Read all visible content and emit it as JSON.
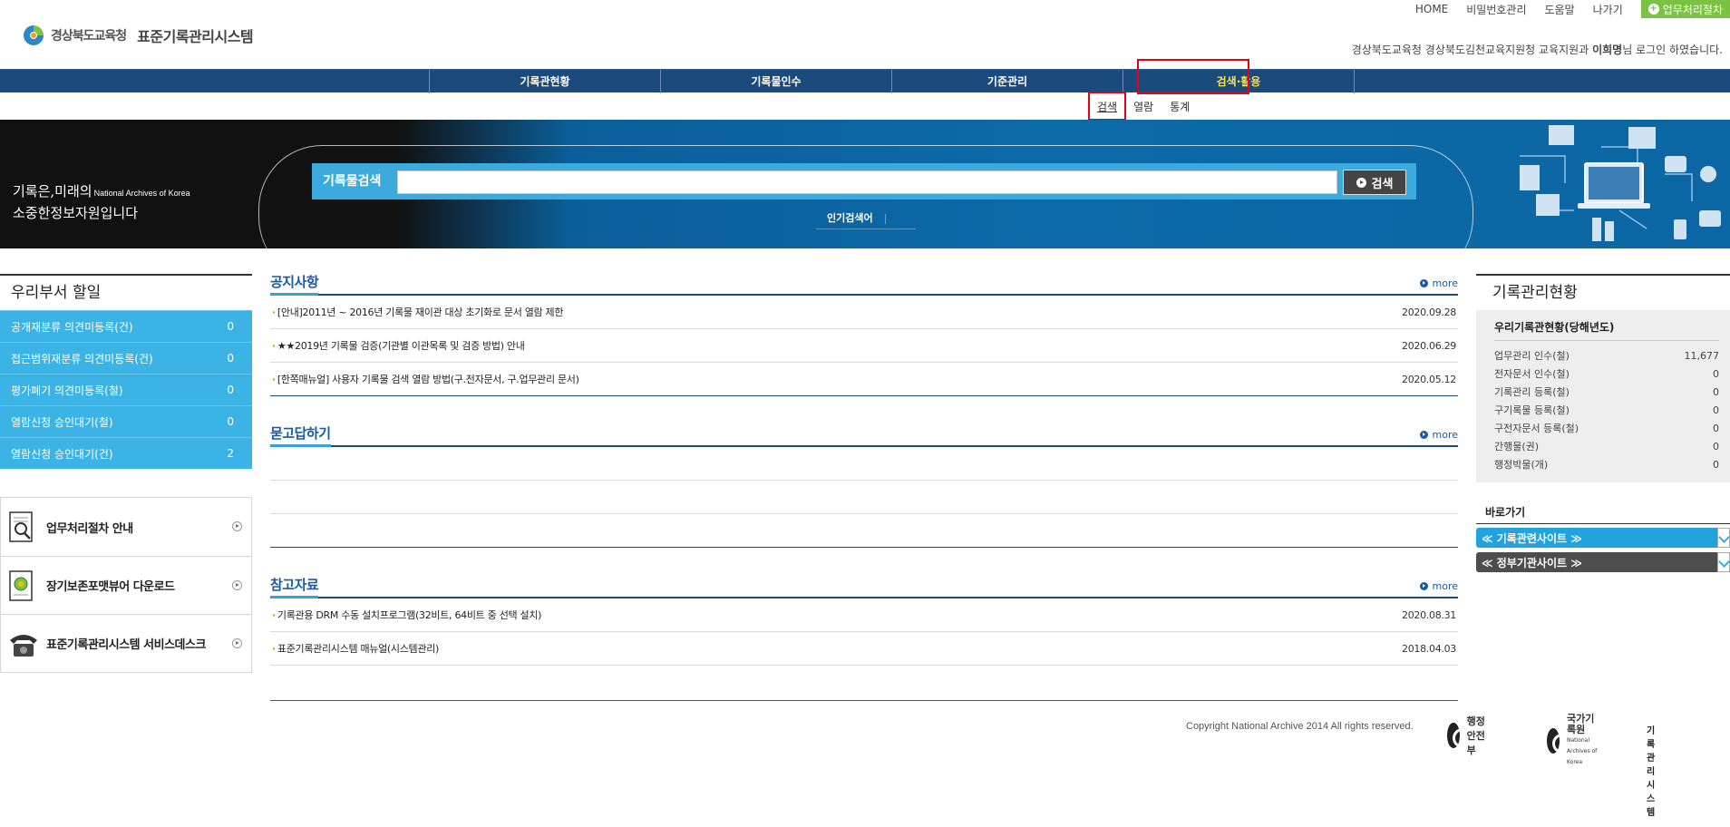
{
  "header": {
    "org_name": "경상북도교육청",
    "system_name": "표준기록관리시스템",
    "top_links": [
      "HOME",
      "비밀번호관리",
      "도움말",
      "나가기"
    ],
    "workflow_button": "업무처리절차",
    "login_prefix": "경상북도교육청 경상북도김천교육지원청 교육지원과 ",
    "login_user": "이희명",
    "login_suffix": "님 로그인 하였습니다."
  },
  "gnb": {
    "items": [
      "기록관현황",
      "기록물인수",
      "기준관리",
      "검색·활용"
    ],
    "active_index": 3,
    "sub_items": [
      "검색",
      "열람",
      "통계"
    ],
    "active_sub_index": 0
  },
  "banner": {
    "slogan_line1": "기록은,미래의",
    "slogan_small": "National Archives of Korea",
    "slogan_line2": "소중한정보자원입니다",
    "search_label": "기록물검색",
    "search_value": "",
    "search_button": "검색",
    "popular_label": "인기검색어"
  },
  "todo": {
    "title": "우리부서 할일",
    "rows": [
      {
        "label": "공개재분류 의견미등록(건)",
        "count": "0"
      },
      {
        "label": "접근범위재분류 의견미등록(건)",
        "count": "0"
      },
      {
        "label": "평가폐기 의견미등록(철)",
        "count": "0"
      },
      {
        "label": "열람신청 승인대기(철)",
        "count": "0"
      },
      {
        "label": "열람신청 승인대기(건)",
        "count": "2"
      }
    ]
  },
  "quick_links": [
    {
      "label": "업무처리절차 안내",
      "icon": "magnifier-document-icon"
    },
    {
      "label": "장기보존포맷뷰어 다운로드",
      "icon": "document-globe-icon"
    },
    {
      "label": "표준기록관리시스템 서비스데스크",
      "icon": "telephone-icon"
    }
  ],
  "notice": {
    "title": "공지사항",
    "more": "more",
    "rows": [
      {
        "subject": "[안내]2011년 ~ 2016년 기록물 재이관 대상 초기화로 문서 열람 제한",
        "date": "2020.09.28"
      },
      {
        "subject": "★★2019년 기록물 검증(기관별 이관목록 및 검증 방법) 안내",
        "date": "2020.06.29"
      },
      {
        "subject": "[한쪽매뉴얼] 사용자 기록물 검색 열람 방법(구.전자문서, 구.업무관리 문서)",
        "date": "2020.05.12"
      }
    ]
  },
  "qna": {
    "title": "묻고답하기",
    "more": "more",
    "rows": []
  },
  "reference": {
    "title": "참고자료",
    "more": "more",
    "rows": [
      {
        "subject": "기록관용 DRM 수동 설치프로그램(32비트, 64비트 중 선택 설치)",
        "date": "2020.08.31"
      },
      {
        "subject": "표준기록관리시스템 매뉴얼(시스템관리)",
        "date": "2018.04.03"
      }
    ]
  },
  "footer": {
    "copyright": "Copyright National Archive 2014 All rights reserved.",
    "logo1": "행정안전부",
    "logo2": "국가기록원",
    "logo2_sub": "National Archives of Korea",
    "logo3": "기록관리시스템"
  },
  "status": {
    "title": "기록관리현황",
    "subtitle": "우리기록관현황(당해년도)",
    "rows": [
      {
        "label": "업무관리 인수(철)",
        "value": "11,677"
      },
      {
        "label": "전자문서 인수(철)",
        "value": "0"
      },
      {
        "label": "기록관리 등록(철)",
        "value": "0"
      },
      {
        "label": "구기록물 등록(철)",
        "value": "0"
      },
      {
        "label": "구전자문서 등록(철)",
        "value": "0"
      },
      {
        "label": "간행물(권)",
        "value": "0"
      },
      {
        "label": "행정박물(개)",
        "value": "0"
      }
    ]
  },
  "shortcut": {
    "title": "바로가기",
    "select1": "≪ 기록관련사이트 ≫",
    "select2": "≪ 정부기관사이트 ≫"
  },
  "colors": {
    "nav_bg": "#1b4a7c",
    "accent_blue": "#3bb4e5",
    "active_menu": "#ffe13d",
    "highlight_red": "#e60012",
    "green_button": "#7cc242"
  }
}
